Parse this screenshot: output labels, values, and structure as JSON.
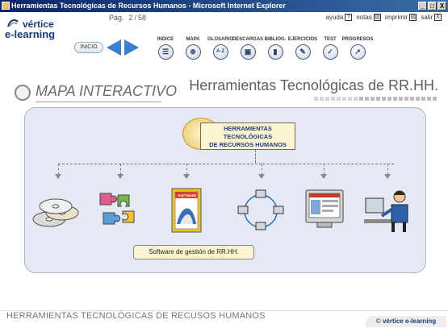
{
  "window": {
    "title": "Herramientas Tecnológicas de Recursos Humanos - Microsoft Internet Explorer",
    "buttons": [
      "_",
      "□",
      "X"
    ]
  },
  "brand": {
    "top": "vértice",
    "bottom": "e-learning"
  },
  "pagination": {
    "label": "Pág.",
    "current": "2",
    "separator": "/",
    "total": "58"
  },
  "utilities": [
    {
      "label": "ayuda",
      "icon": "help-icon",
      "glyph": "?"
    },
    {
      "label": "notas",
      "icon": "notes-icon",
      "glyph": "▤"
    },
    {
      "label": "imprimir",
      "icon": "print-icon",
      "glyph": "▤"
    },
    {
      "label": "salir",
      "icon": "exit-icon",
      "glyph": "X"
    }
  ],
  "nav_start": "INICIO",
  "nav_items": [
    {
      "label": "INDICE",
      "icon": "index-icon",
      "glyph": "☰"
    },
    {
      "label": "MAPA",
      "icon": "map-icon",
      "glyph": "⊕"
    },
    {
      "label": "GLOSARIO",
      "icon": "glossary-icon",
      "glyph": "A-Z"
    },
    {
      "label": "DESCARGAS",
      "icon": "download-icon",
      "glyph": "▣"
    },
    {
      "label": "BIBLIOG.",
      "icon": "bibliography-icon",
      "glyph": "▮"
    },
    {
      "label": "EJERCICIOS",
      "icon": "exercises-icon",
      "glyph": "✎"
    },
    {
      "label": "TEST",
      "icon": "test-icon",
      "glyph": "✓"
    },
    {
      "label": "PROGRESOS",
      "icon": "progress-icon",
      "glyph": "↗"
    }
  ],
  "section_title": "MAPA INTERACTIVO",
  "course_title": "Herramientas Tecnológicas de RR.HH.",
  "map": {
    "root_lines": [
      "HERRAMIENTAS",
      "TECNOLÓGICAS",
      "DE RECURSOS HUMANOS"
    ],
    "nodes": [
      {
        "name": "cds-node",
        "icon": "cd-discs-icon"
      },
      {
        "name": "puzzle-node",
        "icon": "puzzle-pieces-icon"
      },
      {
        "name": "software-node",
        "icon": "software-box-icon",
        "label": "SOFTWARE"
      },
      {
        "name": "network-node",
        "icon": "computer-network-icon"
      },
      {
        "name": "web-node",
        "icon": "web-monitor-icon"
      },
      {
        "name": "person-node",
        "icon": "person-at-computer-icon"
      }
    ],
    "tooltip": "Software de gestión de RR.HH."
  },
  "footer": {
    "title": "HERRAMIENTAS TECNOLÓGICAS DE RECUSOS HUMANOS",
    "copyright_symbol": "©",
    "copyright_brand": "vértice e-learning"
  }
}
